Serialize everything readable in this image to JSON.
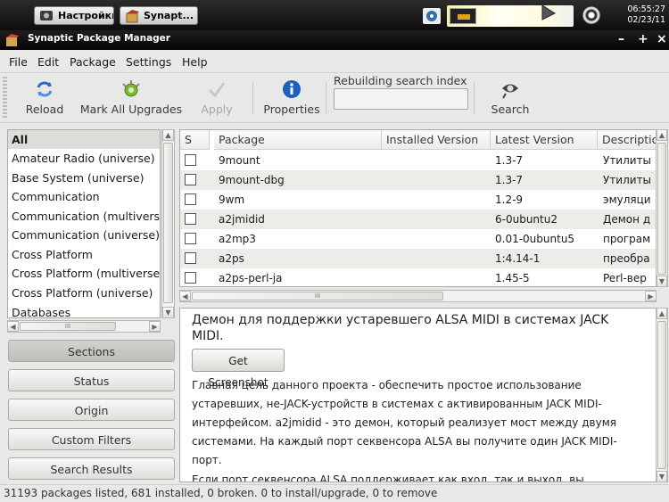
{
  "taskbar": {
    "settings_label": "Настройки",
    "synaptic_label": "Synapt...",
    "clock_time": "06:55:27",
    "clock_date": "02/23/11"
  },
  "window": {
    "title": "Synaptic Package Manager"
  },
  "menu": [
    "File",
    "Edit",
    "Package",
    "Settings",
    "Help"
  ],
  "toolbar": {
    "reload": "Reload",
    "mark_all_upgrades": "Mark All Upgrades",
    "apply": "Apply",
    "properties": "Properties",
    "search_caption": "Rebuilding search index",
    "search_value": "",
    "search": "Search"
  },
  "filters": [
    "All",
    "Amateur Radio (universe)",
    "Base System (universe)",
    "Communication",
    "Communication (multiverse)",
    "Communication (universe)",
    "Cross Platform",
    "Cross Platform (multiverse)",
    "Cross Platform (universe)",
    "Databases"
  ],
  "filter_scroll_center": "III",
  "side_buttons": [
    "Sections",
    "Status",
    "Origin",
    "Custom Filters",
    "Search Results"
  ],
  "table": {
    "columns": [
      "S",
      "Package",
      "Installed Version",
      "Latest Version",
      "Descriptio"
    ],
    "rows": [
      {
        "package": "9mount",
        "installed": "",
        "latest": "1.3-7",
        "desc": "Утилиты"
      },
      {
        "package": "9mount-dbg",
        "installed": "",
        "latest": "1.3-7",
        "desc": "Утилиты"
      },
      {
        "package": "9wm",
        "installed": "",
        "latest": "1.2-9",
        "desc": "эмуляци"
      },
      {
        "package": "a2jmidid",
        "installed": "",
        "latest": "6-0ubuntu2",
        "desc": "Демон д"
      },
      {
        "package": "a2mp3",
        "installed": "",
        "latest": "0.01-0ubuntu5",
        "desc": "програм"
      },
      {
        "package": "a2ps",
        "installed": "",
        "latest": "1:4.14-1",
        "desc": "преобра"
      },
      {
        "package": "a2ps-perl-ja",
        "installed": "",
        "latest": "1.45-5",
        "desc": "Perl-вер"
      }
    ],
    "scroll_center": "III"
  },
  "details": {
    "title": "Демон для поддержки устаревшего ALSA MIDI в системах JACK MIDI.",
    "screenshot_button": "Get Screenshot",
    "paragraphs": [
      "Главная цель данного проекта - обеспечить простое использование устаревших, не-JACK-устройств в системах с активированным JACK MIDI-интерфейсом. a2jmidid - это демон, который реализует мост между двумя системами. На каждый порт секвенсора ALSA вы получите один JACK MIDI-порт.",
      "Если порт секвенсора ALSA поддерживает как вход, так и выход, вы"
    ]
  },
  "status": "31193 packages listed, 681 installed, 0 broken. 0 to install/upgrade, 0 to remove"
}
